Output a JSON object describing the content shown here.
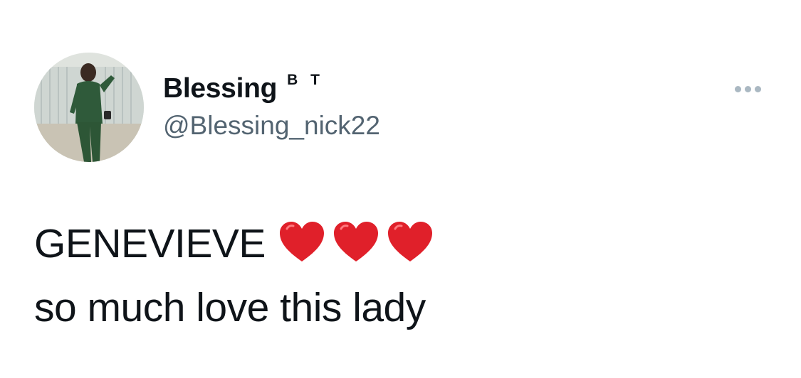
{
  "author": {
    "display_name": "Blessing",
    "name_suffix": "B T",
    "handle": "@Blessing_nick22",
    "avatar_icon": "profile-photo"
  },
  "more_menu": {
    "icon": "more-horizontal-icon"
  },
  "tweet": {
    "line1": "GENEVIEVE",
    "line1_emoji": [
      "red-heart",
      "red-heart",
      "red-heart"
    ],
    "line2": "so much love this lady"
  },
  "colors": {
    "text": "#0f1419",
    "handle": "#536471",
    "heart": "#e0202a",
    "more_dots": "#aab8c2"
  }
}
